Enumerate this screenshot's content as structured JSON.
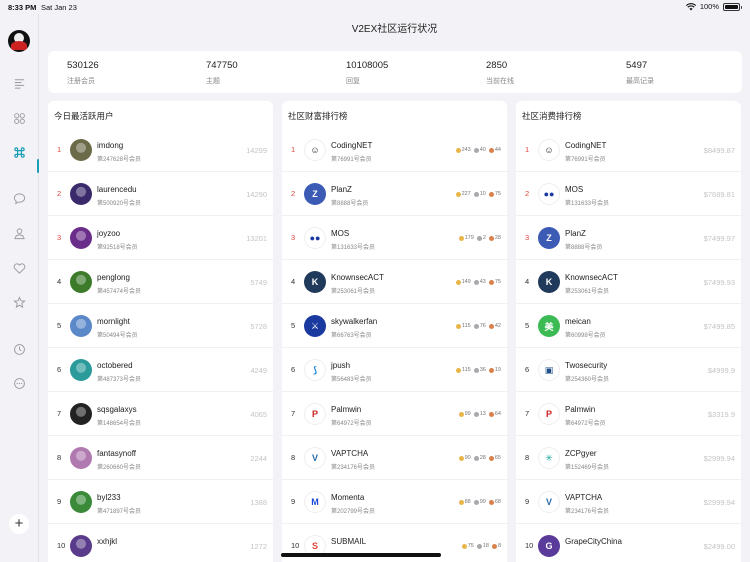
{
  "status": {
    "time": "8:33 PM",
    "date": "Sat Jan 23",
    "battery": "100%"
  },
  "title": "V2EX社区运行状况",
  "sidebar": {
    "icons": [
      "list-icon",
      "grid-icon",
      "command-icon",
      "chat-bubble-icon",
      "person-icon",
      "heart-icon",
      "star-icon",
      "clock-icon",
      "more-circle-icon"
    ],
    "active": "command-icon",
    "add_label": "+"
  },
  "stats": [
    {
      "value": "530126",
      "label": "注册会员"
    },
    {
      "value": "747750",
      "label": "主题"
    },
    {
      "value": "10108005",
      "label": "回复"
    },
    {
      "value": "2850",
      "label": "当前在线"
    },
    {
      "value": "5497",
      "label": "最高记录"
    }
  ],
  "active_users": {
    "title": "今日最活跃用户",
    "rows": [
      {
        "rank": "1",
        "name": "imdong",
        "sub": "第247628号会员",
        "value": "14299"
      },
      {
        "rank": "2",
        "name": "laurencedu",
        "sub": "第500920号会员",
        "value": "14290"
      },
      {
        "rank": "3",
        "name": "joyzoo",
        "sub": "第92518号会员",
        "value": "13201"
      },
      {
        "rank": "4",
        "name": "penglong",
        "sub": "第457474号会员",
        "value": "5749"
      },
      {
        "rank": "5",
        "name": "mornlight",
        "sub": "第50494号会员",
        "value": "5728"
      },
      {
        "rank": "6",
        "name": "octobered",
        "sub": "第487373号会员",
        "value": "4249"
      },
      {
        "rank": "7",
        "name": "sqsgalaxys",
        "sub": "第148654号会员",
        "value": "4065"
      },
      {
        "rank": "8",
        "name": "fantasynoff",
        "sub": "第260660号会员",
        "value": "2244"
      },
      {
        "rank": "9",
        "name": "byl233",
        "sub": "第471897号会员",
        "value": "1388"
      },
      {
        "rank": "10",
        "name": "xxhjkl",
        "sub": "",
        "value": "1272"
      }
    ]
  },
  "wealth": {
    "title": "社区财富排行榜",
    "rows": [
      {
        "rank": "1",
        "name": "CodingNET",
        "sub": "第76991号会员",
        "gold": "243",
        "silver": "40",
        "bronze": "44"
      },
      {
        "rank": "2",
        "name": "PlanZ",
        "sub": "第8888号会员",
        "gold": "227",
        "silver": "10",
        "bronze": "75"
      },
      {
        "rank": "3",
        "name": "MOS",
        "sub": "第131633号会员",
        "gold": "179",
        "silver": "2",
        "bronze": "28"
      },
      {
        "rank": "4",
        "name": "KnownsecACT",
        "sub": "第253061号会员",
        "gold": "149",
        "silver": "43",
        "bronze": "75"
      },
      {
        "rank": "5",
        "name": "skywalkerfan",
        "sub": "第66763号会员",
        "gold": "115",
        "silver": "76",
        "bronze": "42"
      },
      {
        "rank": "6",
        "name": "jpush",
        "sub": "第56483号会员",
        "gold": "115",
        "silver": "36",
        "bronze": "19"
      },
      {
        "rank": "7",
        "name": "Palmwin",
        "sub": "第64972号会员",
        "gold": "99",
        "silver": "13",
        "bronze": "64"
      },
      {
        "rank": "8",
        "name": "VAPTCHA",
        "sub": "第234176号会员",
        "gold": "90",
        "silver": "28",
        "bronze": "65"
      },
      {
        "rank": "9",
        "name": "Momenta",
        "sub": "第202799号会员",
        "gold": "88",
        "silver": "99",
        "bronze": "68"
      },
      {
        "rank": "10",
        "name": "SUBMAIL",
        "sub": "",
        "gold": "75",
        "silver": "18",
        "bronze": "8"
      }
    ]
  },
  "spending": {
    "title": "社区消费排行榜",
    "rows": [
      {
        "rank": "1",
        "name": "CodingNET",
        "sub": "第76991号会员",
        "value": "$8499.87"
      },
      {
        "rank": "2",
        "name": "MOS",
        "sub": "第131633号会员",
        "value": "$7689.81"
      },
      {
        "rank": "3",
        "name": "PlanZ",
        "sub": "第8888号会员",
        "value": "$7499.97"
      },
      {
        "rank": "4",
        "name": "KnownsecACT",
        "sub": "第253061号会员",
        "value": "$7499.93"
      },
      {
        "rank": "5",
        "name": "meican",
        "sub": "第60998号会员",
        "value": "$7499.85"
      },
      {
        "rank": "6",
        "name": "Twosecurity",
        "sub": "第254360号会员",
        "value": "$4999.9"
      },
      {
        "rank": "7",
        "name": "Palmwin",
        "sub": "第64972号会员",
        "value": "$3319.9"
      },
      {
        "rank": "8",
        "name": "ZCPgyer",
        "sub": "第152469号会员",
        "value": "$2999.94"
      },
      {
        "rank": "9",
        "name": "VAPTCHA",
        "sub": "第234176号会员",
        "value": "$2999.94"
      },
      {
        "rank": "10",
        "name": "GrapeCityChina",
        "sub": "",
        "value": "$2499.00"
      }
    ]
  },
  "colors": {
    "accent": "#1a9db5",
    "rank_top": "#e2453c",
    "muted_value": "#c4c4c8"
  }
}
